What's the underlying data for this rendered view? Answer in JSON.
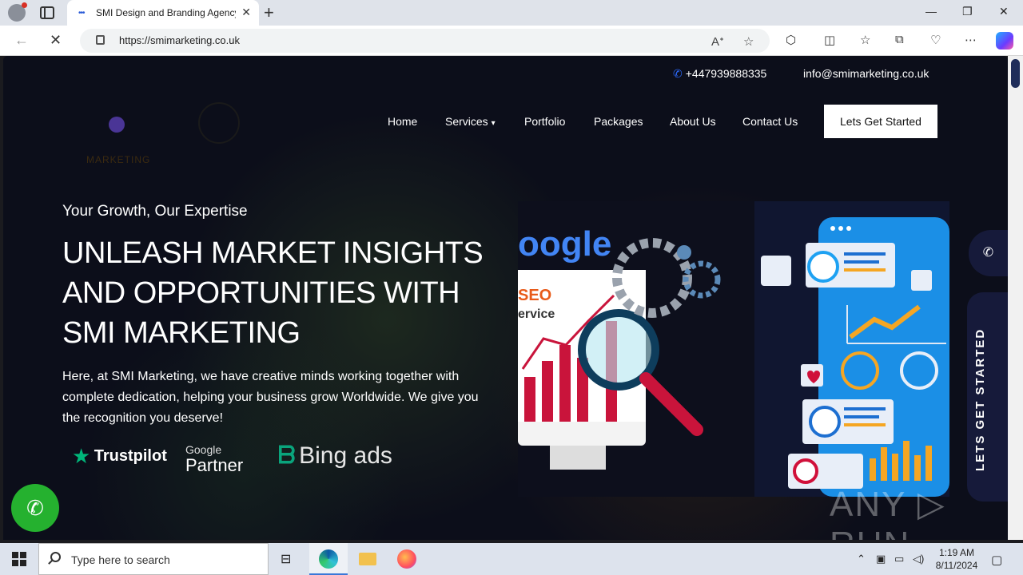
{
  "browser": {
    "tab_title": "SMI Design and Branding Agency",
    "new_tab_glyph": "+",
    "tab_close_glyph": "✕",
    "url": "https://smimarketing.co.uk",
    "window_controls": {
      "minimize": "—",
      "restore": "❐",
      "close": "✕"
    },
    "icons": [
      "profile-icon",
      "workspaces-icon",
      "back-icon",
      "reload-icon",
      "lock-icon",
      "read-aloud-icon",
      "favorite-star-icon",
      "extensions-icon",
      "split-screen-icon",
      "favorites-icon",
      "collections-icon",
      "browser-essentials-icon",
      "more-icon",
      "copilot-icon"
    ]
  },
  "topbar": {
    "phone": "+447939888335",
    "email": "info@smimarketing.co.uk"
  },
  "logo": {
    "word": "MARKETING"
  },
  "nav": {
    "items": [
      "Home",
      "Services",
      "Portfolio",
      "Packages",
      "About Us",
      "Contact Us"
    ],
    "cta": "Lets Get Started"
  },
  "hero": {
    "kicker": "Your Growth, Our Expertise",
    "title": "UNLEASH MARKET INSIGHTS AND OPPORTUNITIES WITH SMI MARKETING",
    "description": "Here, at SMI Marketing, we have creative minds working together with complete dedication, helping your business grow Worldwide. We give you the recognition you deserve!"
  },
  "partners": {
    "trustpilot": "Trustpilot",
    "google_top": "Google",
    "google_bottom": "Partner",
    "bing": "Bing ads"
  },
  "illustration": {
    "google_text": "oogle",
    "seo_line1": "SEO",
    "seo_line2": "ervice"
  },
  "side": {
    "phone_icon": "phone-icon",
    "cta_vertical": "LETS GET STARTED"
  },
  "watermark": "ANY ▷ RUN",
  "taskbar": {
    "search_placeholder": "Type here to search",
    "time": "1:19 AM",
    "date": "8/11/2024"
  }
}
